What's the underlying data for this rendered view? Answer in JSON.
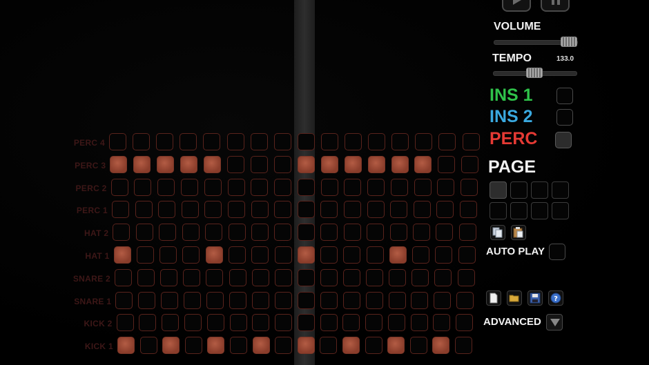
{
  "transport": {
    "play_icon": "play-icon",
    "pause_icon": "pause-icon"
  },
  "mixer": {
    "volume_label": "VOLUME",
    "volume_level": 0.93,
    "tempo_label": "TEMPO",
    "tempo_value": "133.0",
    "tempo_level": 0.5
  },
  "tracks": [
    {
      "label": "INS 1",
      "color": "#2fc24a",
      "checked": false
    },
    {
      "label": "INS 2",
      "color": "#3aa9e0",
      "checked": false
    },
    {
      "label": "PERC",
      "color": "#e53a34",
      "checked": true
    }
  ],
  "pages": {
    "label": "PAGE",
    "selected": 1,
    "count": 8
  },
  "tools": [
    "copy-icon",
    "paste-icon"
  ],
  "autoplay": {
    "label": "AUTO PLAY",
    "checked": false
  },
  "file_tools": [
    "new-file-icon",
    "open-folder-icon",
    "save-icon",
    "help-icon"
  ],
  "advanced": {
    "label": "ADVANCED"
  },
  "colors": {
    "active_step": "#a34f3a",
    "step_border": "#5a231c",
    "label_dim": "#3d1717"
  },
  "sequencer": {
    "steps": 16,
    "playhead_step": 8,
    "rows": [
      {
        "label": "PERC 4",
        "active": []
      },
      {
        "label": "PERC 3",
        "active": [
          1,
          2,
          3,
          4,
          5,
          9,
          10,
          11,
          12,
          13,
          14
        ]
      },
      {
        "label": "PERC 2",
        "active": []
      },
      {
        "label": "PERC 1",
        "active": []
      },
      {
        "label": "HAT 2",
        "active": []
      },
      {
        "label": "HAT 1",
        "active": [
          1,
          5,
          9,
          13
        ]
      },
      {
        "label": "SNARE 2",
        "active": []
      },
      {
        "label": "SNARE 1",
        "active": []
      },
      {
        "label": "KICK 2",
        "active": []
      },
      {
        "label": "KICK 1",
        "active": [
          1,
          3,
          5,
          7,
          9,
          11,
          13,
          15
        ]
      }
    ]
  }
}
